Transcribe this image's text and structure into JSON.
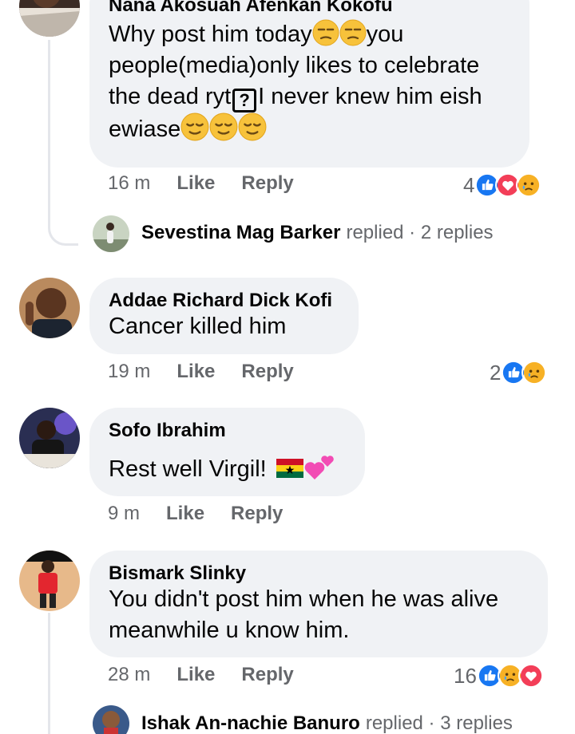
{
  "comments": [
    {
      "author": "Nana Akosuah Afenkan Kokofu",
      "text_parts": [
        "Why post him today",
        "you people(media)only likes to celebrate the dead ryt",
        "I never knew him eish ewiase"
      ],
      "qbox": "?",
      "time": "16 m",
      "like": "Like",
      "reply": "Reply",
      "reaction_count": "4",
      "reactions": [
        "like-icon",
        "love-icon",
        "sad-icon"
      ],
      "replies": {
        "name": "Sevestina Mag Barker",
        "rest": "replied · 2 replies"
      }
    },
    {
      "author": "Addae Richard Dick Kofi",
      "text": "Cancer killed him",
      "time": "19 m",
      "like": "Like",
      "reply": "Reply",
      "reaction_count": "2",
      "reactions": [
        "like-icon",
        "sad-icon"
      ]
    },
    {
      "author": "Sofo Ibrahim",
      "text": "Rest well Virgil!",
      "time": "9 m",
      "like": "Like",
      "reply": "Reply"
    },
    {
      "author": "Bismark Slinky",
      "text_line1": "You didn't post him when he was alive",
      "text_line2": "meanwhile u know him.",
      "time": "28 m",
      "like": "Like",
      "reply": "Reply",
      "reaction_count": "16",
      "reactions": [
        "like-icon",
        "sad-icon",
        "love-icon"
      ],
      "replies": {
        "name": "Ishak An-nachie Banuro",
        "rest": "replied · 3 replies"
      }
    }
  ],
  "colors": {
    "like": "#1877f2",
    "love": "#f33e58",
    "sad": "#f7b125",
    "bubble": "#f0f2f5",
    "muted": "#65676b"
  }
}
